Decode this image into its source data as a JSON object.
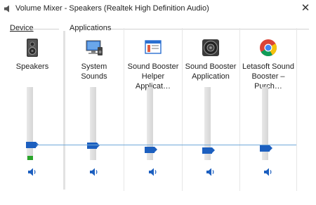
{
  "window": {
    "title": "Volume Mixer - Speakers (Realtek High Definition Audio)",
    "close_glyph": "✕"
  },
  "sections": {
    "device": "Device",
    "applications": "Applications"
  },
  "device": {
    "label": "Speakers",
    "icon": "speaker-device-icon",
    "volume_percent": 25
  },
  "apps": [
    {
      "label_line1": "System Sounds",
      "label_line2": "",
      "icon": "system-sounds-icon",
      "volume_percent": 25
    },
    {
      "label_line1": "Sound Booster",
      "label_line2": "Helper Applicat…",
      "icon": "app-window-icon",
      "volume_percent": 20
    },
    {
      "label_line1": "Sound Booster",
      "label_line2": "Application",
      "icon": "speaker-circle-icon",
      "volume_percent": 19
    },
    {
      "label_line1": "Letasoft Sound",
      "label_line2": "Booster – Purch…",
      "icon": "chrome-icon",
      "volume_percent": 21
    }
  ],
  "colors": {
    "accent": "#1c5fbf",
    "track": "#dcdcdc"
  }
}
